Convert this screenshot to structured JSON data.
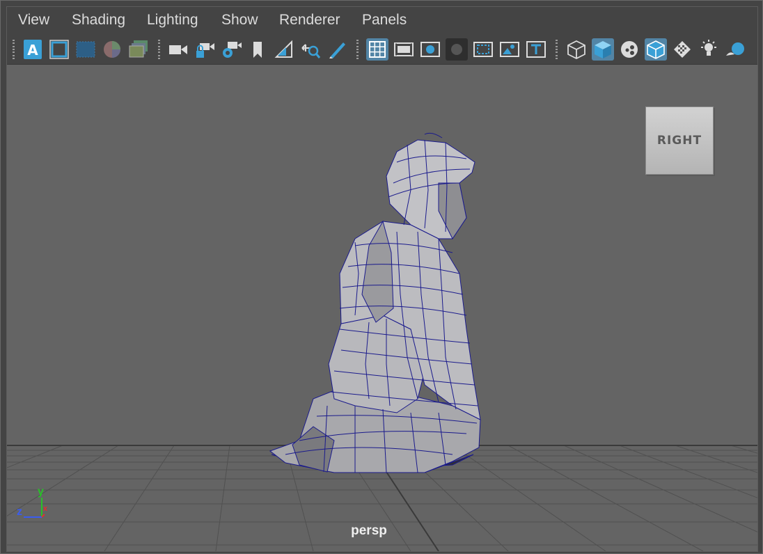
{
  "menu": [
    "View",
    "Shading",
    "Lighting",
    "Show",
    "Renderer",
    "Panels"
  ],
  "icons": [
    "select-camera-icon",
    "camera-attributes-icon",
    "bookmarks-icon",
    "image-plane-icon",
    "grease-pencil-icon",
    "camera-icon",
    "lock-camera-icon",
    "camera-settings-icon",
    "bookmark-icon",
    "two-d-pan-zoom-icon",
    "pan-zoom-icon",
    "grease-pencil-brush-icon",
    "grid-icon",
    "film-gate-icon",
    "resolution-gate-icon",
    "gate-mask-icon",
    "field-chart-icon",
    "safe-action-icon",
    "safe-title-icon",
    "wireframe-icon",
    "smooth-shade-icon",
    "use-default-material-icon",
    "wireframe-on-shaded-icon",
    "xray-icon",
    "use-all-lights-icon",
    "shadows-icon"
  ],
  "viewcube": {
    "label": "RIGHT"
  },
  "camera": {
    "name": "persp"
  },
  "axes": {
    "y": "y",
    "z": "z",
    "x": "x"
  },
  "colors": {
    "accent": "#5285a6",
    "viewport_bg": "#646464",
    "mesh": "#b4b4b8",
    "wire": "#1a1a8c"
  }
}
